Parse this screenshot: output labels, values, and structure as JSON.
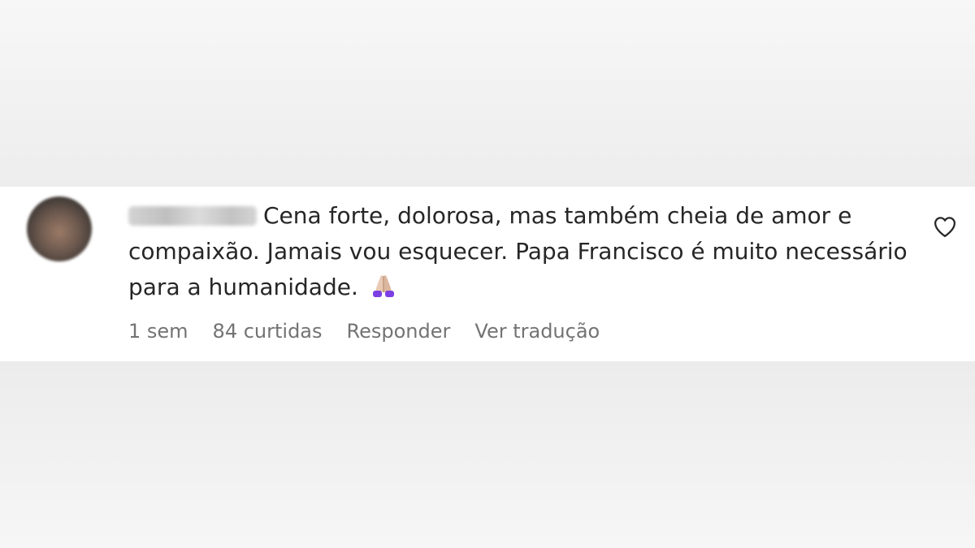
{
  "comment": {
    "text": "Cena forte, dolorosa, mas também cheia de amor e compaixão. Jamais vou esquecer. Papa Francisco é muito necessário para a humanidade.",
    "emoji": "praying-hands-emoji",
    "meta": {
      "time": "1 sem",
      "likes": "84 curtidas",
      "reply_label": "Responder",
      "translate_label": "Ver tradução"
    },
    "like_icon": "heart-outline-icon"
  },
  "colors": {
    "text": "#262626",
    "meta": "#737373",
    "card_background": "#ffffff",
    "page_background": "#f0f0f0"
  }
}
